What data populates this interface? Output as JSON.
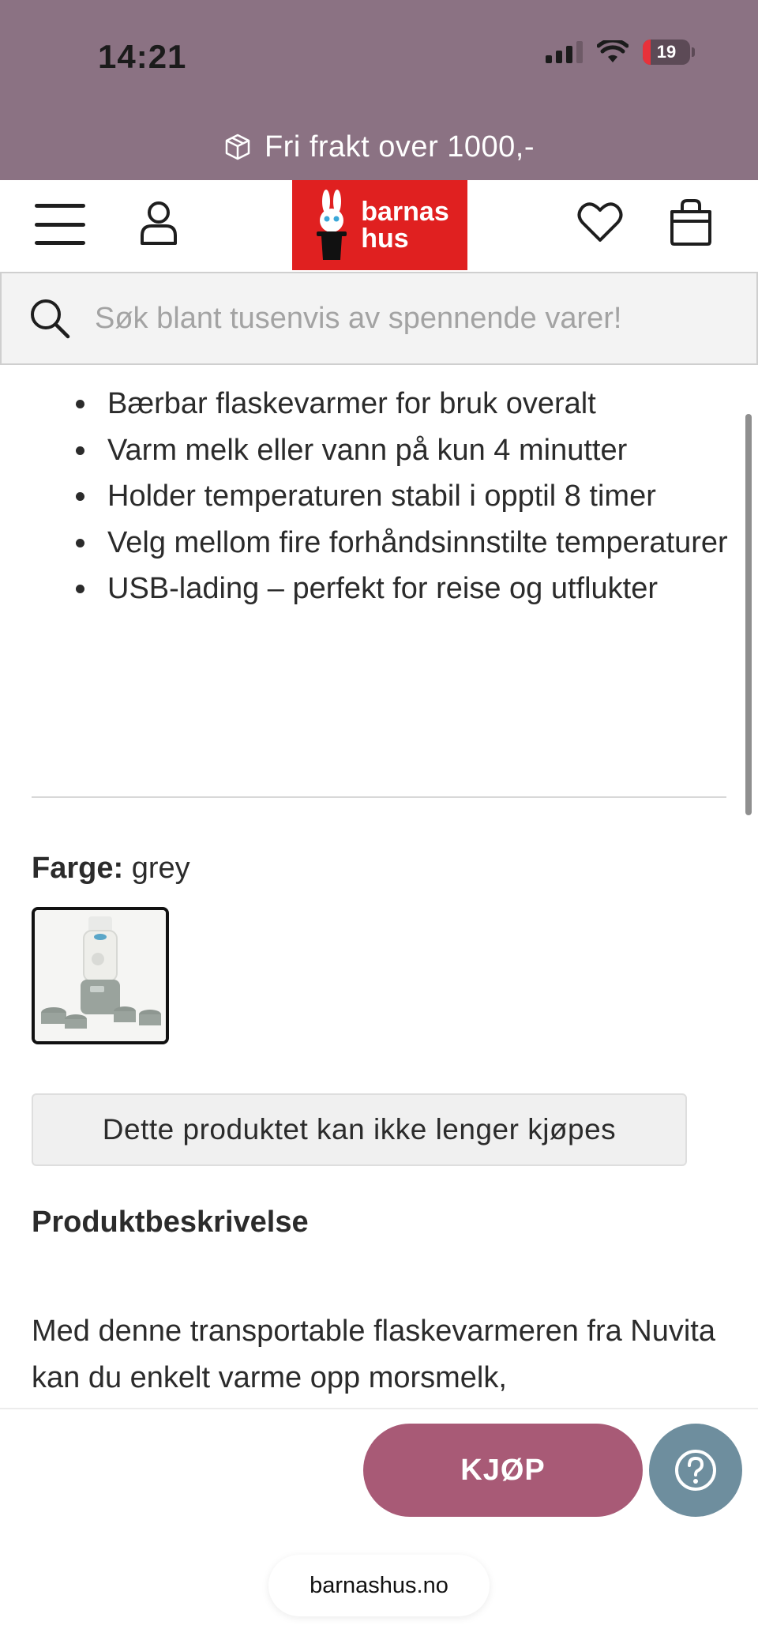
{
  "status_bar": {
    "time": "14:21",
    "battery": "19"
  },
  "promo": {
    "text": "Fri frakt over 1000,-"
  },
  "header": {
    "logo_line1": "barnas",
    "logo_line2": "hus"
  },
  "search": {
    "placeholder": "Søk blant tusenvis av spennende varer!"
  },
  "features": [
    "Bærbar flaskevarmer for bruk overalt",
    "Varm melk eller vann på kun 4 minutter",
    "Holder temperaturen stabil i opptil 8 timer",
    "Velg mellom fire forhåndsinnstilte temperaturer",
    "USB-lading – perfekt for reise og utflukter"
  ],
  "color": {
    "label": "Farge:",
    "value": "grey"
  },
  "unavailable_text": "Dette produktet kan ikke lenger kjøpes",
  "description": {
    "title": "Produktbeskrivelse",
    "text": "Med denne transportable flaskevarmeren fra Nuvita kan du enkelt varme opp morsmelk,"
  },
  "actions": {
    "buy_label": "KJØP"
  },
  "browser": {
    "url": "barnashus.no"
  },
  "colors": {
    "brand_purple": "#8b7283",
    "logo_red": "#e02020",
    "buy_button": "#a85a76",
    "help_button": "#6e8e9e"
  }
}
